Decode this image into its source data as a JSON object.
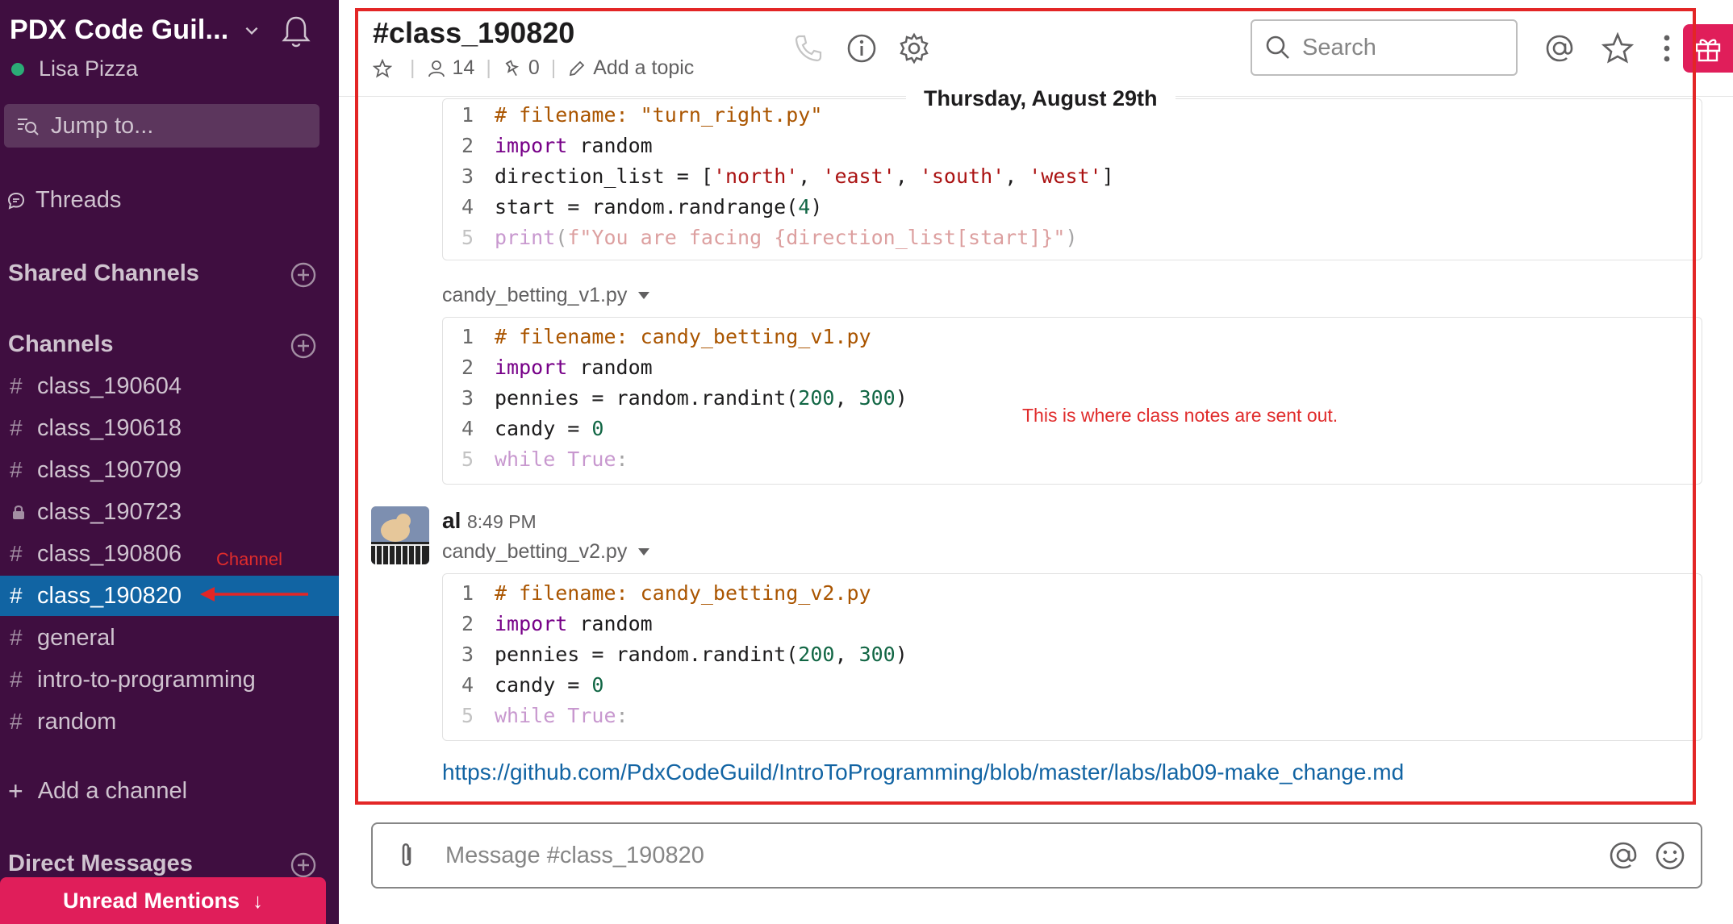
{
  "sidebar": {
    "team_name": "PDX Code Guil...",
    "user_name": "Lisa Pizza",
    "jump_to": "Jump to...",
    "threads": "Threads",
    "shared_channels": "Shared Channels",
    "channels_heading": "Channels",
    "channels": [
      {
        "name": "class_190604",
        "icon": "hash-icon"
      },
      {
        "name": "class_190618",
        "icon": "hash-icon"
      },
      {
        "name": "class_190709",
        "icon": "hash-icon"
      },
      {
        "name": "class_190723",
        "icon": "lock-icon"
      },
      {
        "name": "class_190806",
        "icon": "hash-icon"
      },
      {
        "name": "class_190820",
        "icon": "hash-icon",
        "active": true
      },
      {
        "name": "general",
        "icon": "hash-icon"
      },
      {
        "name": "intro-to-programming",
        "icon": "hash-icon"
      },
      {
        "name": "random",
        "icon": "hash-icon"
      }
    ],
    "hash_symbol": "#",
    "add_channel": "Add a channel",
    "direct_messages": "Direct Messages",
    "unread_mentions": "Unread Mentions",
    "annotation": "Channel"
  },
  "header": {
    "channel_title": "#class_190820",
    "members_count": "14",
    "pins_count": "0",
    "add_topic": "Add a topic",
    "search_placeholder": "Search"
  },
  "date_divider": "Thursday, August 29th",
  "messages": {
    "first_snippet_lines": [
      "1",
      "2",
      "3",
      "4",
      "5"
    ],
    "snippet1_file": "candy_betting_v1.py",
    "author": "al",
    "time": "8:49 PM",
    "snippet2_file": "candy_betting_v2.py",
    "link": "https://github.com/PdxCodeGuild/IntroToProgramming/blob/master/labs/lab09-make_change.md",
    "annotation": "This is where class notes are sent out."
  },
  "composer": {
    "placeholder": "Message #class_190820"
  },
  "colors": {
    "sidebar_bg": "#3f0e40",
    "active_channel": "#1164a3",
    "unread_bg": "#e01e5a",
    "annotation_red": "#e32626",
    "link": "#1264a3"
  }
}
